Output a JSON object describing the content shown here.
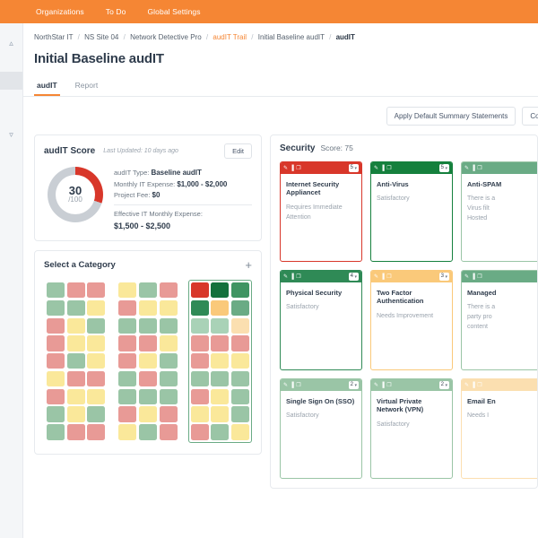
{
  "topnav": {
    "items": [
      {
        "label": "Organizations"
      },
      {
        "label": "To Do"
      },
      {
        "label": "Global Settings"
      }
    ],
    "bg": "#f58634"
  },
  "breadcrumb": {
    "items": [
      "NorthStar IT",
      "NS Site 04",
      "Network Detective Pro",
      "audIT Trail",
      "Initial Baseline audIT",
      "audIT"
    ],
    "accent_index": 3,
    "current_index": 5,
    "separator": "/"
  },
  "page": {
    "title": "Initial Baseline audIT"
  },
  "tabs": [
    {
      "label": "audIT",
      "active": true
    },
    {
      "label": "Report",
      "active": false
    }
  ],
  "actions": [
    {
      "label": "Apply Default Summary Statements"
    },
    {
      "label": "Copy T"
    }
  ],
  "score_card": {
    "title": "audIT Score",
    "last_updated": "Last Updated: 10 days ago",
    "edit_label": "Edit",
    "score": "30",
    "score_max": "/100",
    "score_percent": 30,
    "ring_color": "#d8372a",
    "ring_track": "#c9ced4",
    "type_label": "audIT Type:",
    "type_value": "Baseline audIT",
    "monthly_label": "Monthly IT Expense:",
    "monthly_value": "$1,000  -  $2,000",
    "fee_label": "Project Fee:",
    "fee_value": "$0",
    "effective_label": "Effective IT Monthly Expense:",
    "effective_value": "$1,500  -  $2,500"
  },
  "category": {
    "title": "Select a Category",
    "add_icon": "+",
    "groups": [
      {
        "selected": false,
        "cells": [
          "#9ac5a6",
          "#e89a96",
          "#e89a96",
          "#9ac5a6",
          "#9ac5a6",
          "#fae89a",
          "#e89a96",
          "#fae89a",
          "#9ac5a6",
          "#e89a96",
          "#fae89a",
          "#fae89a",
          "#e89a96",
          "#9ac5a6",
          "#fae89a",
          "#fae89a",
          "#e89a96",
          "#e89a96",
          "#e89a96",
          "#fae89a",
          "#fae89a",
          "#9ac5a6",
          "#fae89a",
          "#9ac5a6",
          "#9ac5a6",
          "#e89a96",
          "#e89a96"
        ]
      },
      {
        "selected": false,
        "cells": [
          "#fae89a",
          "#9ac5a6",
          "#e89a96",
          "#e89a96",
          "#fae89a",
          "#fae89a",
          "#9ac5a6",
          "#9ac5a6",
          "#9ac5a6",
          "#e89a96",
          "#e89a96",
          "#fae89a",
          "#e89a96",
          "#fae89a",
          "#9ac5a6",
          "#9ac5a6",
          "#e89a96",
          "#9ac5a6",
          "#9ac5a6",
          "#9ac5a6",
          "#9ac5a6",
          "#e89a96",
          "#fae89a",
          "#e89a96",
          "#fae89a",
          "#9ac5a6",
          "#e89a96"
        ]
      },
      {
        "selected": true,
        "cells": [
          "#d8372a",
          "#14713c",
          "#3f9462",
          "#2f8a56",
          "#fac97a",
          "#6aab85",
          "#a9d2b7",
          "#a9d2b7",
          "#fbdfb0",
          "#e89a96",
          "#e89a96",
          "#e89a96",
          "#e89a96",
          "#fae89a",
          "#fae89a",
          "#9ac5a6",
          "#9ac5a6",
          "#9ac5a6",
          "#e89a96",
          "#fae89a",
          "#9ac5a6",
          "#fae89a",
          "#fae89a",
          "#9ac5a6",
          "#e89a96",
          "#9ac5a6",
          "#fae89a"
        ]
      }
    ]
  },
  "security": {
    "title": "Security",
    "score_label": "Score: 75",
    "card_icons": [
      "edit-icon",
      "chart-icon",
      "copy-icon"
    ],
    "cards": [
      {
        "name": "Internet Security Appliancet",
        "desc": "Requires Immediate Attention",
        "rating": "5",
        "color": "#d8372a",
        "border": "#d8372a"
      },
      {
        "name": "Anti-Virus",
        "desc": "Satisfactory",
        "rating": "5",
        "color": "#15803d",
        "border": "#15803d"
      },
      {
        "name": "Anti-SPAM",
        "desc": "There is a\nVirus filt\nHosted",
        "rating": "",
        "color": "#6aab85",
        "border": "#9ac5a6"
      },
      {
        "name": "Physical Security",
        "desc": "Satisfactory",
        "rating": "4",
        "color": "#2f8a56",
        "border": "#2f8a56"
      },
      {
        "name": "Two Factor Authentication",
        "desc": "Needs Improvement",
        "rating": "3",
        "color": "#fac97a",
        "border": "#fac97a"
      },
      {
        "name": "Managed",
        "desc": "There is a\nparty pro\ncontent",
        "rating": "",
        "color": "#6aab85",
        "border": "#9ac5a6"
      },
      {
        "name": "Single Sign On (SSO)",
        "desc": "Satisfactory",
        "rating": "2",
        "color": "#9ac5a6",
        "border": "#9ac5a6"
      },
      {
        "name": "Virtual Private Network (VPN)",
        "desc": "Satisfactory",
        "rating": "2",
        "color": "#9ac5a6",
        "border": "#9ac5a6"
      },
      {
        "name": "Email En",
        "desc": "Needs I",
        "rating": "",
        "color": "#fbdfb0",
        "border": "#fbdfb0"
      }
    ]
  }
}
